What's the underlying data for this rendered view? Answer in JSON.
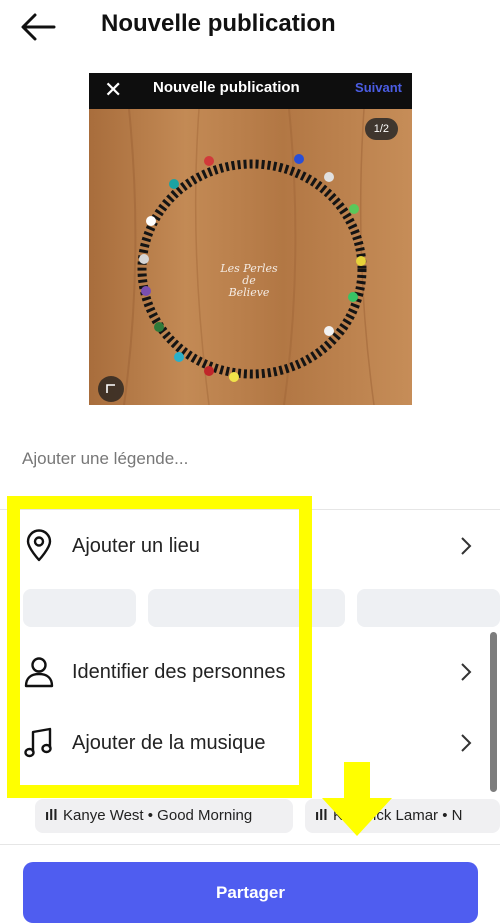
{
  "header": {
    "title": "Nouvelle publication"
  },
  "post_image": {
    "inner_title": "Nouvelle publication",
    "inner_next": "Suivant",
    "page_counter": "1/2",
    "watermark": "Les Perles de Believe"
  },
  "caption": {
    "placeholder": "Ajouter une légende..."
  },
  "options": [
    {
      "label": "Ajouter un lieu",
      "icon": "location-pin-icon"
    },
    {
      "label": "Identifier des personnes",
      "icon": "person-icon"
    },
    {
      "label": "Ajouter de la musique",
      "icon": "music-note-icon"
    }
  ],
  "music_suggestions": [
    {
      "label": "Kanye West • Good Morning"
    },
    {
      "label": "Kendrick Lamar • N"
    }
  ],
  "share_button": {
    "label": "Partager",
    "color": "#4f5df0"
  },
  "annotation": {
    "highlight_color": "#ffff00"
  }
}
